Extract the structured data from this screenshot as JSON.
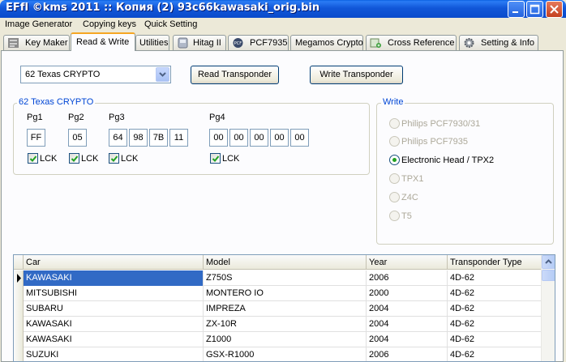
{
  "window": {
    "title": "EFfI  ©kms 2011 :: Копия (2) 93c66kawasaki_orig.bin",
    "icon": "app-icon"
  },
  "menu": {
    "items": [
      {
        "label": "Image Generator"
      },
      {
        "label": "Copying keys"
      },
      {
        "label": "Quick Setting"
      }
    ]
  },
  "tabs": [
    {
      "label": "Key Maker",
      "icon": "key-maker-icon"
    },
    {
      "label": "Read & Write",
      "active": true
    },
    {
      "label": "Utilities"
    },
    {
      "label": "Hitag II",
      "icon": "hitag-icon"
    },
    {
      "label": "PCF7935",
      "icon": "pcf-icon"
    },
    {
      "label": "Megamos Crypto"
    },
    {
      "label": "Cross Reference",
      "icon": "cross-reference-icon"
    },
    {
      "label": "Setting & Info",
      "icon": "gear-icon"
    }
  ],
  "transponder_select": {
    "value": "62 Texas CRYPTO"
  },
  "buttons": {
    "read": "Read Transponder",
    "write": "Write Transponder"
  },
  "crypto_group": {
    "legend": "62 Texas CRYPTO",
    "pages": [
      {
        "label": "Pg1",
        "bytes": [
          "FF"
        ],
        "lock_label": "LCK",
        "locked": true
      },
      {
        "label": "Pg2",
        "bytes": [
          "05"
        ],
        "lock_label": "LCK",
        "locked": true
      },
      {
        "label": "Pg3",
        "bytes": [
          "64",
          "98",
          "7B",
          "11"
        ],
        "lock_label": "LCK",
        "locked": true
      },
      {
        "label": "Pg4",
        "bytes": [
          "00",
          "00",
          "00",
          "00",
          "00"
        ],
        "lock_label": "LCK",
        "locked": true
      }
    ]
  },
  "write_group": {
    "legend": "Write",
    "options": [
      {
        "label": "Philips PCF7930/31",
        "selected": false,
        "enabled": false
      },
      {
        "label": "Philips PCF7935",
        "selected": false,
        "enabled": false
      },
      {
        "label": "Electronic Head / TPX2",
        "selected": true,
        "enabled": true
      },
      {
        "label": "TPX1",
        "selected": false,
        "enabled": false
      },
      {
        "label": "Z4C",
        "selected": false,
        "enabled": false
      },
      {
        "label": "T5",
        "selected": false,
        "enabled": false
      }
    ]
  },
  "table": {
    "columns": [
      "Car",
      "Model",
      "Year",
      "Transponder Type"
    ],
    "rows": [
      [
        "KAWASAKI",
        "Z750S",
        "2006",
        "4D-62"
      ],
      [
        "MITSUBISHI",
        "MONTERO IO",
        "2000",
        "4D-62"
      ],
      [
        "SUBARU",
        "IMPREZA",
        "2004",
        "4D-62"
      ],
      [
        "KAWASAKI",
        "ZX-10R",
        "2004",
        "4D-62"
      ],
      [
        "KAWASAKI",
        "Z1000",
        "2004",
        "4D-62"
      ],
      [
        "SUZUKI",
        "GSX-R1000",
        "2006",
        "4D-62"
      ]
    ]
  },
  "colors": {
    "titlebar": "#0a4bcb",
    "group_legend": "#0046d5",
    "selection": "#316ac5",
    "active_tab_accent": "#f5a623"
  }
}
